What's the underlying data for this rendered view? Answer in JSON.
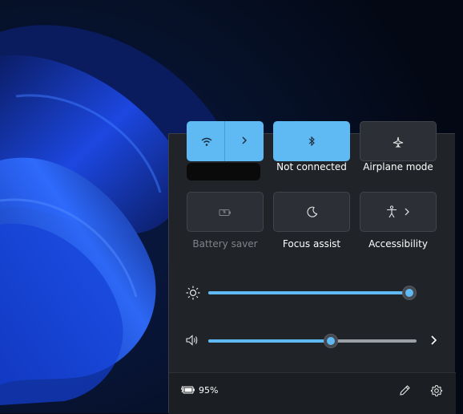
{
  "quick_settings": {
    "tiles": [
      {
        "label": "",
        "state": "on",
        "icon": "wifi-icon",
        "has_expand": true
      },
      {
        "label": "Not connected",
        "state": "on",
        "icon": "bluetooth-icon"
      },
      {
        "label": "Airplane mode",
        "state": "off",
        "icon": "airplane-icon"
      },
      {
        "label": "Battery saver",
        "state": "disabled",
        "icon": "battery-saver-icon"
      },
      {
        "label": "Focus assist",
        "state": "off",
        "icon": "moon-icon"
      },
      {
        "label": "Accessibility",
        "state": "off",
        "icon": "accessibility-icon",
        "has_expand": true
      }
    ],
    "brightness": {
      "icon": "sun-icon",
      "value_fraction": 0.99
    },
    "volume": {
      "icon": "speaker-icon",
      "value_fraction": 0.59
    },
    "footer": {
      "battery_percent": "95%",
      "battery_icon": "battery-charging-icon",
      "edit_icon": "pencil-icon",
      "settings_icon": "gear-icon"
    }
  },
  "colors": {
    "accent": "#5fb9f3",
    "panel": "#202429",
    "tile_off": "#2c3036",
    "footer": "#1b1e22"
  }
}
